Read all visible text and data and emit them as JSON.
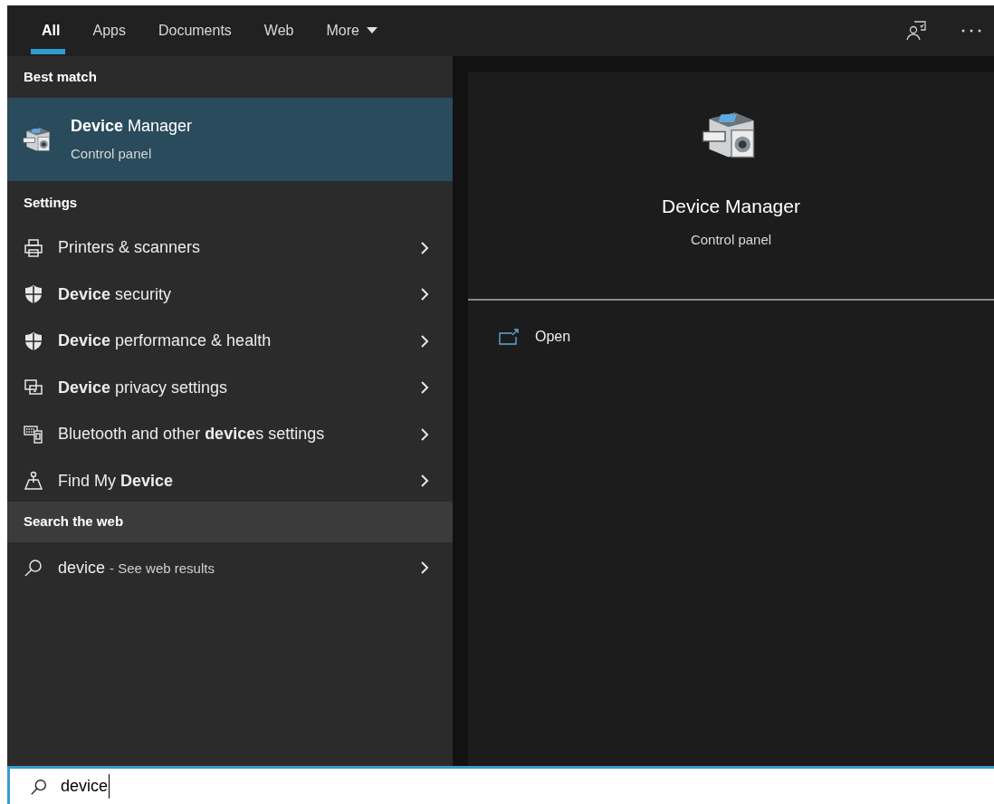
{
  "tabs": [
    {
      "label": "All",
      "selected": true,
      "kind": "plain"
    },
    {
      "label": "Apps",
      "selected": false,
      "kind": "plain"
    },
    {
      "label": "Documents",
      "selected": false,
      "kind": "plain"
    },
    {
      "label": "Web",
      "selected": false,
      "kind": "plain"
    },
    {
      "label": "More",
      "selected": false,
      "kind": "dropdown"
    }
  ],
  "best_match": {
    "heading": "Best match",
    "title": "**Device** Manager",
    "subtitle": "Control panel",
    "selected": true
  },
  "settings": {
    "heading": "Settings",
    "items": [
      {
        "kind": "printer",
        "label": "Printers & scanners"
      },
      {
        "kind": "shield",
        "label": "**Device** security"
      },
      {
        "kind": "shield",
        "label": "**Device** performance & health"
      },
      {
        "kind": "privacy",
        "label": "**Device** privacy settings"
      },
      {
        "kind": "keyboard",
        "label": "Bluetooth and other **device**s settings"
      },
      {
        "kind": "person",
        "label": "Find My **Device**"
      }
    ]
  },
  "web": {
    "heading": "Search the web",
    "query": "device",
    "hint": "- See web results"
  },
  "preview": {
    "title": "Device Manager",
    "subtitle": "Control panel",
    "actions": [
      {
        "label": "Open"
      }
    ]
  },
  "search": {
    "value": "device"
  }
}
